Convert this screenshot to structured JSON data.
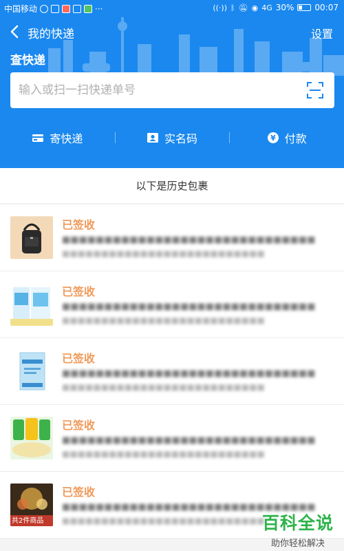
{
  "status_bar": {
    "carrier": "中国移动",
    "battery": "30%",
    "time": "00:07",
    "signal_text": "4G"
  },
  "nav": {
    "back_icon": "chevron-left-icon",
    "title": "我的快递",
    "settings": "设置"
  },
  "search": {
    "section_title": "查快递",
    "placeholder": "输入或扫一扫快递单号",
    "scan_icon": "scan-icon"
  },
  "actions": [
    {
      "label": "寄快递",
      "icon": "package-card-icon"
    },
    {
      "label": "实名码",
      "icon": "id-card-icon"
    },
    {
      "label": "付款",
      "icon": "yen-coin-icon"
    }
  ],
  "history": {
    "header": "以下是历史包裹",
    "items": [
      {
        "status": "已签收",
        "desc": "■■■■■■■■■■■■■■■■■■■■■■■■■■■■■■",
        "sub": "■■■■■■■■■■■■■■■■■■■■■■■■■■",
        "thumb": "backpack"
      },
      {
        "status": "已签收",
        "desc": "■■■■■■■■■■■■■■■■■■■■■■■■■■■■■■",
        "sub": "■■■■■■■■■■■■■■■■■■■■■■■■■■",
        "thumb": "tissue-pack"
      },
      {
        "status": "已签收",
        "desc": "■■■■■■■■■■■■■■■■■■■■■■■■■■■■■■",
        "sub": "■■■■■■■■■■■■■■■■■■■■■■■■■■",
        "thumb": "book"
      },
      {
        "status": "已签收",
        "desc": "■■■■■■■■■■■■■■■■■■■■■■■■■■■■■■",
        "sub": "■■■■■■■■■■■■■■■■■■■■■■■■■■",
        "thumb": "snack-bags"
      },
      {
        "status": "已签收",
        "desc": "■■■■■■■■■■■■■■■■■■■■■■■■■■■■■■",
        "sub": "■■■■■■■■■■■■■■■■■■■■■■■■■■",
        "thumb": "fireworks",
        "thumb_text": "共2件商品"
      }
    ]
  },
  "watermark": {
    "main": "百科全说",
    "sub": "助你轻松解决"
  },
  "colors": {
    "header_blue": "#1a88ef",
    "signed_orange": "#f09a5a",
    "watermark_green": "#2db34a"
  }
}
